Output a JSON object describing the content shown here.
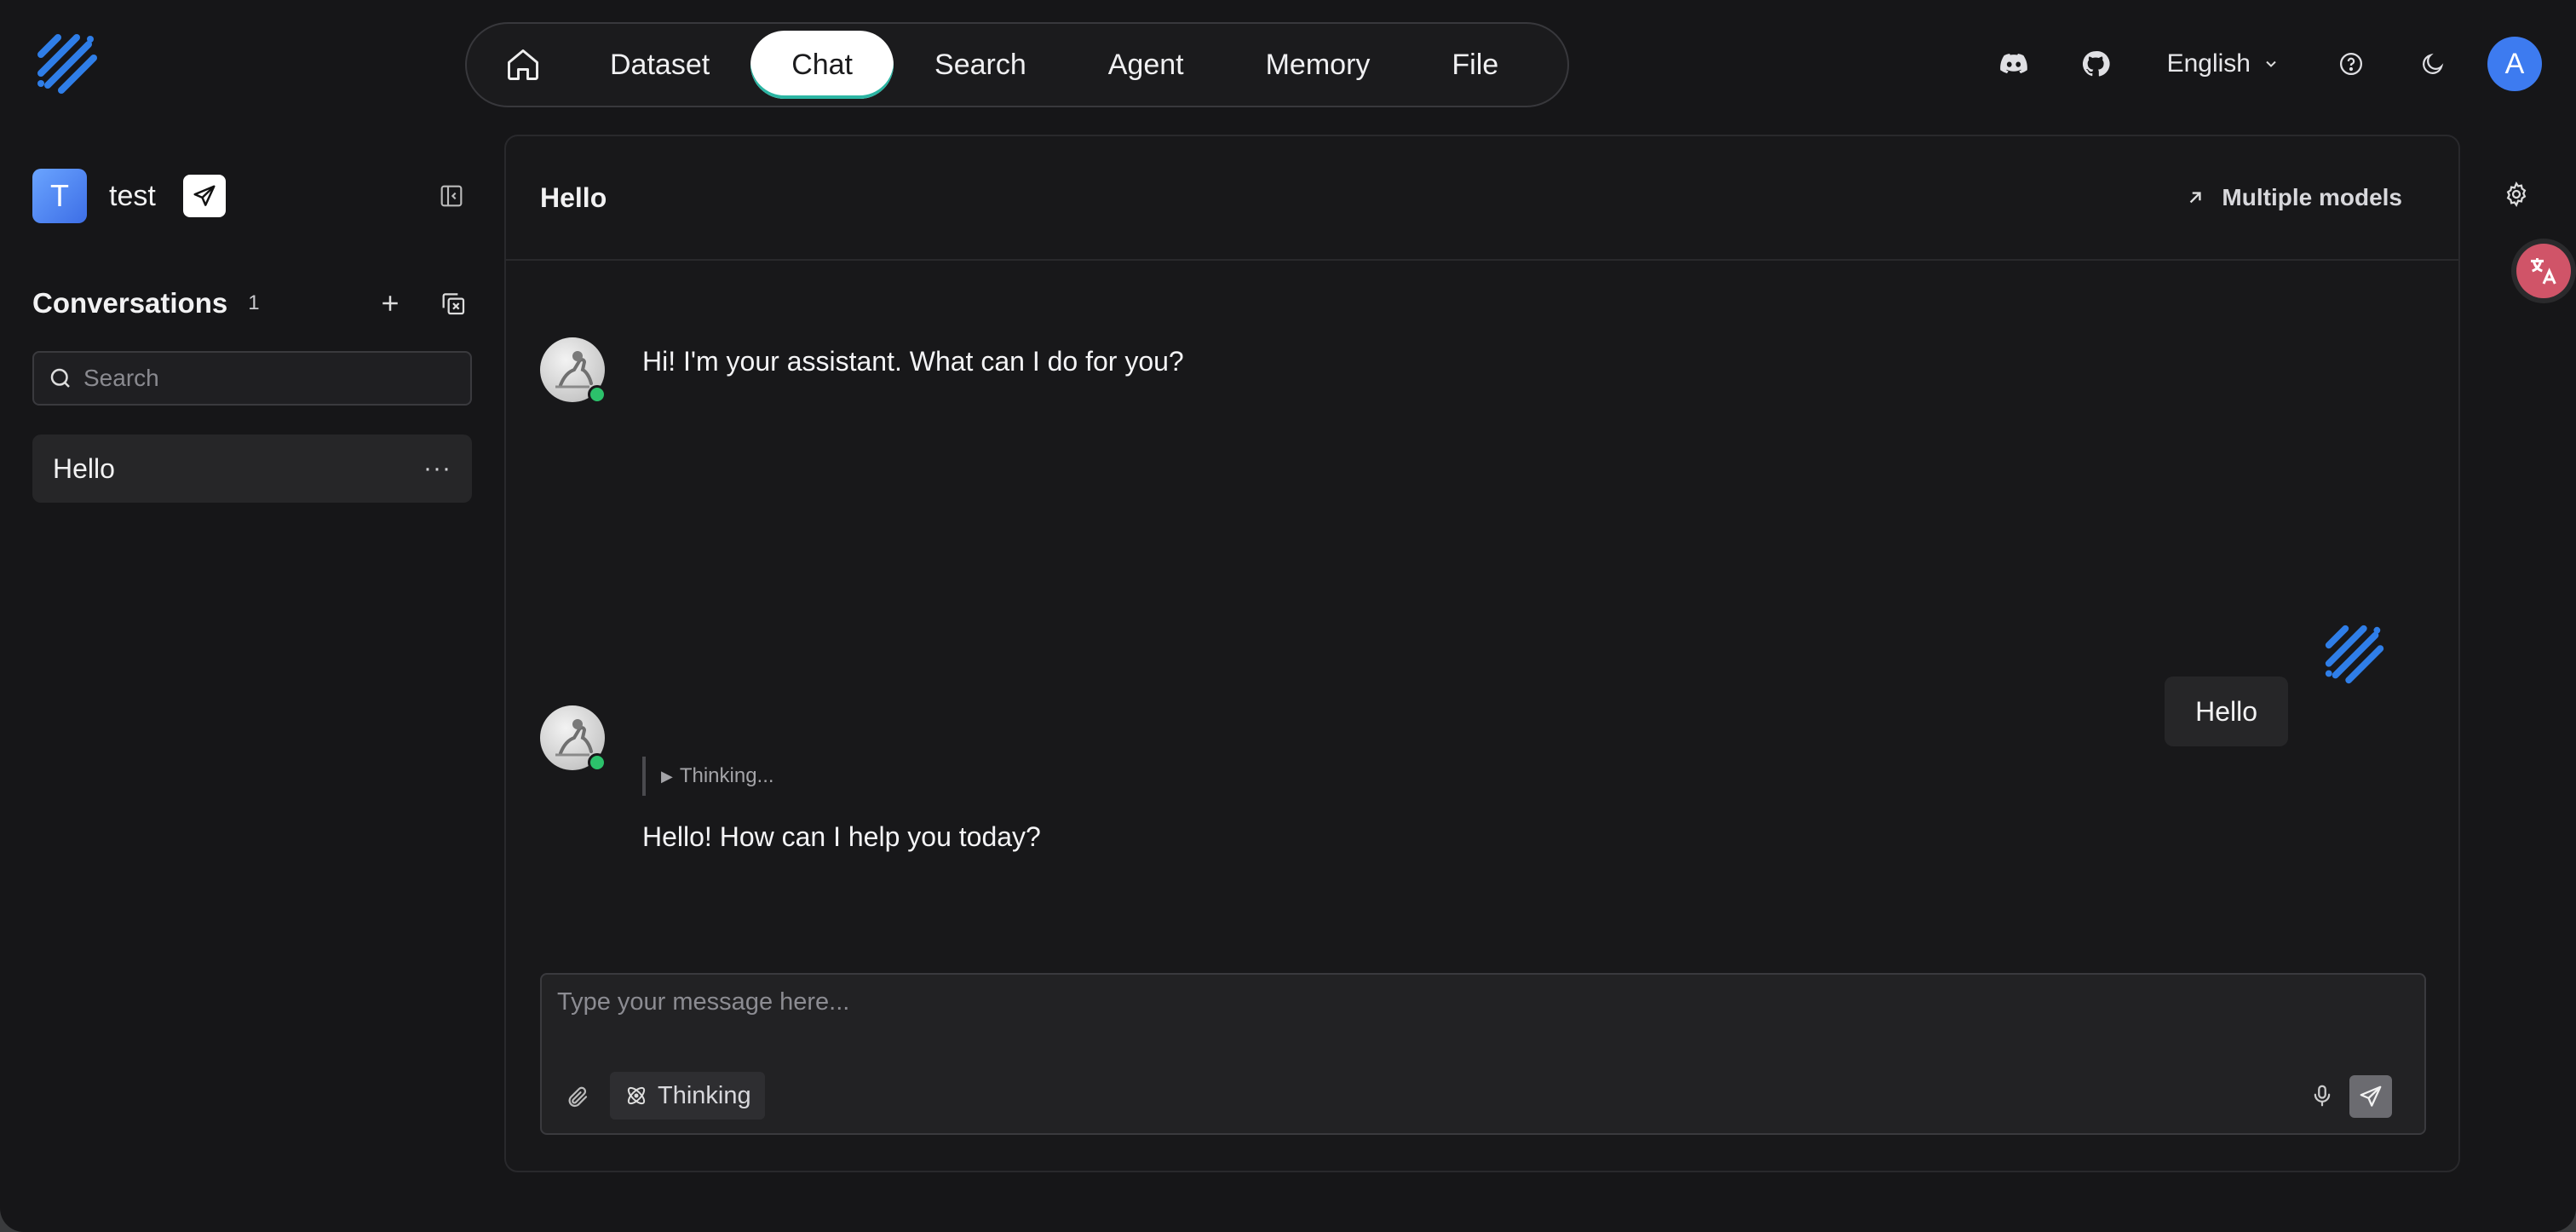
{
  "nav": {
    "home_icon": "home-icon",
    "items": [
      "Dataset",
      "Chat",
      "Search",
      "Agent",
      "Memory",
      "File"
    ],
    "active": "Chat"
  },
  "top_right": {
    "language": "English",
    "user_initial": "A",
    "icons": [
      "discord-icon",
      "github-icon",
      "help-icon",
      "moon-icon"
    ]
  },
  "sidebar": {
    "app_initial": "T",
    "app_name": "test",
    "conversations_label": "Conversations",
    "conversations_count": "1",
    "search_placeholder": "Search",
    "items": [
      {
        "label": "Hello",
        "more": "···"
      }
    ]
  },
  "chat": {
    "title": "Hello",
    "multiple_models_label": "Multiple models",
    "messages": {
      "greeting": "Hi! I'm your assistant. What can I do for you?",
      "user": "Hello",
      "thinking": "Thinking...",
      "reply": "Hello! How can I help you today?"
    },
    "composer": {
      "placeholder": "Type your message here...",
      "thinking_label": "Thinking"
    }
  },
  "colors": {
    "accent": "#3d7bf0",
    "active_underline": "#2bb5a3",
    "online": "#2cc16b",
    "translate_fab": "#d05468"
  }
}
